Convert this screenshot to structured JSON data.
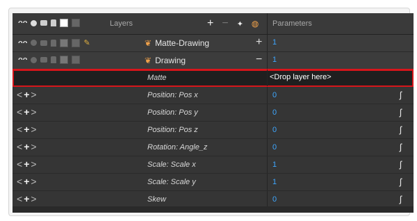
{
  "header": {
    "title": "Layers",
    "params_title": "Parameters"
  },
  "layers": [
    {
      "name": "Matte-Drawing",
      "value": "1",
      "toggle": "+"
    },
    {
      "name": "Drawing",
      "value": "1",
      "toggle": "−"
    }
  ],
  "matte": {
    "label": "Matte",
    "value": "<Drop layer here>"
  },
  "params": [
    {
      "label": "Position: Pos x",
      "value": "0"
    },
    {
      "label": "Position: Pos y",
      "value": "0"
    },
    {
      "label": "Position: Pos z",
      "value": "0"
    },
    {
      "label": "Rotation: Angle_z",
      "value": "0"
    },
    {
      "label": "Scale: Scale x",
      "value": "1"
    },
    {
      "label": "Scale: Scale y",
      "value": "1"
    },
    {
      "label": "Skew",
      "value": "0"
    }
  ],
  "colors": {
    "accent_value": "#3ea7ff",
    "highlight": "#d8151b"
  }
}
